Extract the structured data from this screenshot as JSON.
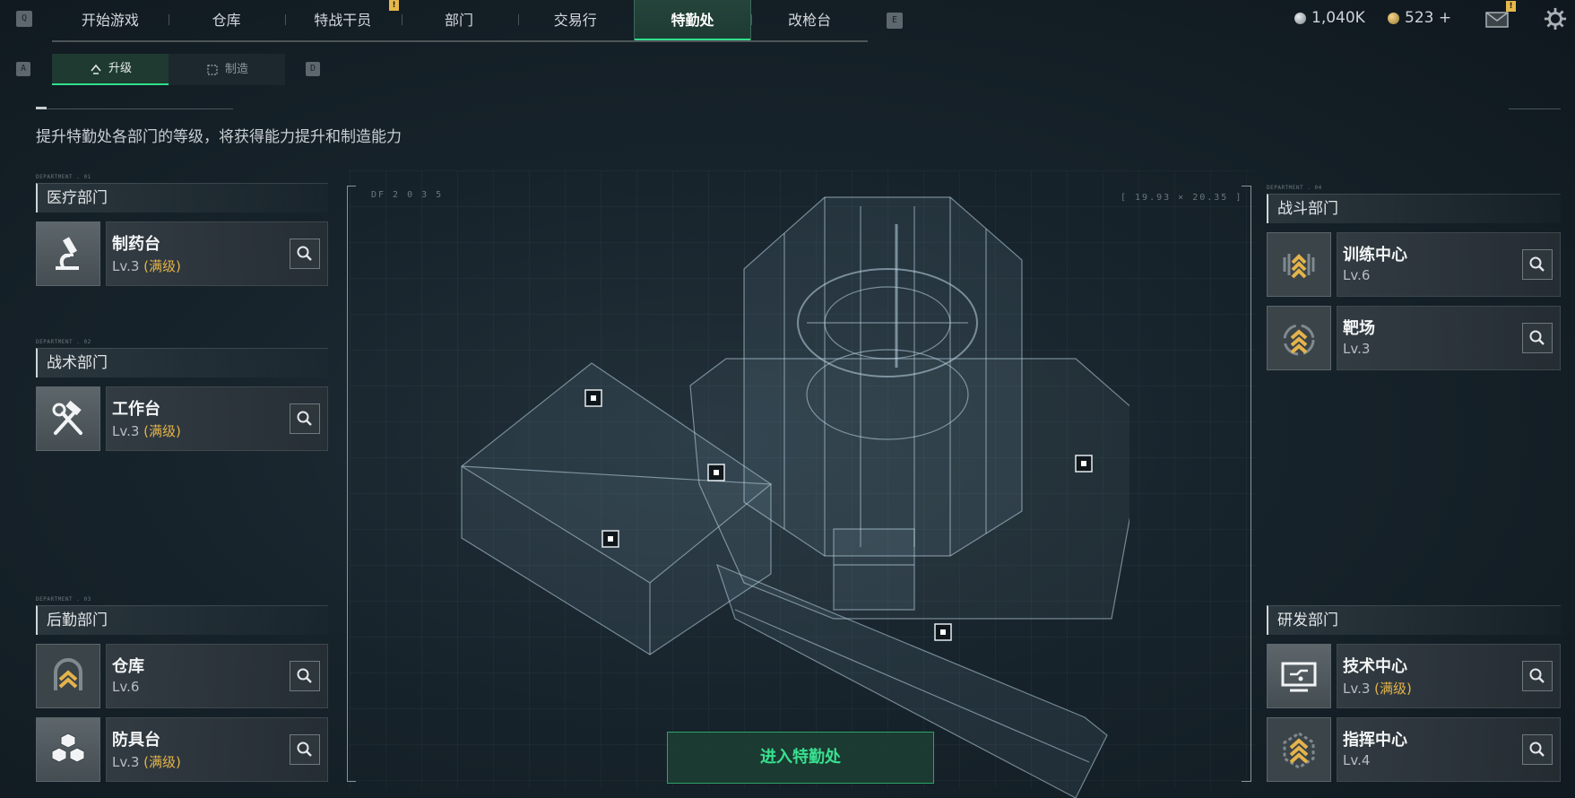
{
  "keys": {
    "prev_tab": "Q",
    "next_tab": "E",
    "prev_sub": "A",
    "next_sub": "D"
  },
  "tabs": [
    {
      "label": "开始游戏",
      "active": false
    },
    {
      "label": "仓库",
      "active": false
    },
    {
      "label": "特战干员",
      "active": false,
      "badge": "!"
    },
    {
      "label": "部门",
      "active": false
    },
    {
      "label": "交易行",
      "active": false
    },
    {
      "label": "特勤处",
      "active": true
    },
    {
      "label": "改枪台",
      "active": false
    }
  ],
  "currency": {
    "silver": "1,040K",
    "gold": "523 +"
  },
  "mail_badge": "!",
  "subtabs": [
    {
      "label": "升级",
      "active": true
    },
    {
      "label": "制造",
      "active": false
    }
  ],
  "description": "提升特勤处各部门的等级，将获得能力提升和制造能力",
  "hud": {
    "code": "DF 2 0 3 5",
    "range": "[ 19.93 × 20.35 ]"
  },
  "departments": {
    "medical": {
      "micro": "DEPARTMENT . 01",
      "title": "医疗部门",
      "items": [
        {
          "name": "制药台",
          "level": "Lv.3",
          "max": "(满级)",
          "icon": "microscope-icon"
        }
      ]
    },
    "tactical": {
      "micro": "DEPARTMENT . 02",
      "title": "战术部门",
      "items": [
        {
          "name": "工作台",
          "level": "Lv.3",
          "max": "(满级)",
          "icon": "hammer-wrench-icon"
        }
      ]
    },
    "logistics": {
      "micro": "DEPARTMENT . 03",
      "title": "后勤部门",
      "items": [
        {
          "name": "仓库",
          "level": "Lv.6",
          "max": "",
          "icon": "storage-chevron-icon"
        },
        {
          "name": "防具台",
          "level": "Lv.3",
          "max": "(满级)",
          "icon": "armor-cubes-icon"
        }
      ]
    },
    "combat": {
      "micro": "DEPARTMENT . 04",
      "title": "战斗部门",
      "items": [
        {
          "name": "训练中心",
          "level": "Lv.6",
          "max": "",
          "icon": "training-chevron-icon"
        },
        {
          "name": "靶场",
          "level": "Lv.3",
          "max": "",
          "icon": "target-chevron-icon"
        }
      ]
    },
    "research": {
      "micro": "",
      "title": "研发部门",
      "items": [
        {
          "name": "技术中心",
          "level": "Lv.3",
          "max": "(满级)",
          "icon": "monitor-icon"
        },
        {
          "name": "指挥中心",
          "level": "Lv.4",
          "max": "",
          "icon": "command-chevron-icon"
        }
      ]
    }
  },
  "enter_button": "进入特勤处",
  "colors": {
    "accent": "#2fe08a",
    "max_level": "#e4b34b",
    "badge": "#e6b84a"
  }
}
